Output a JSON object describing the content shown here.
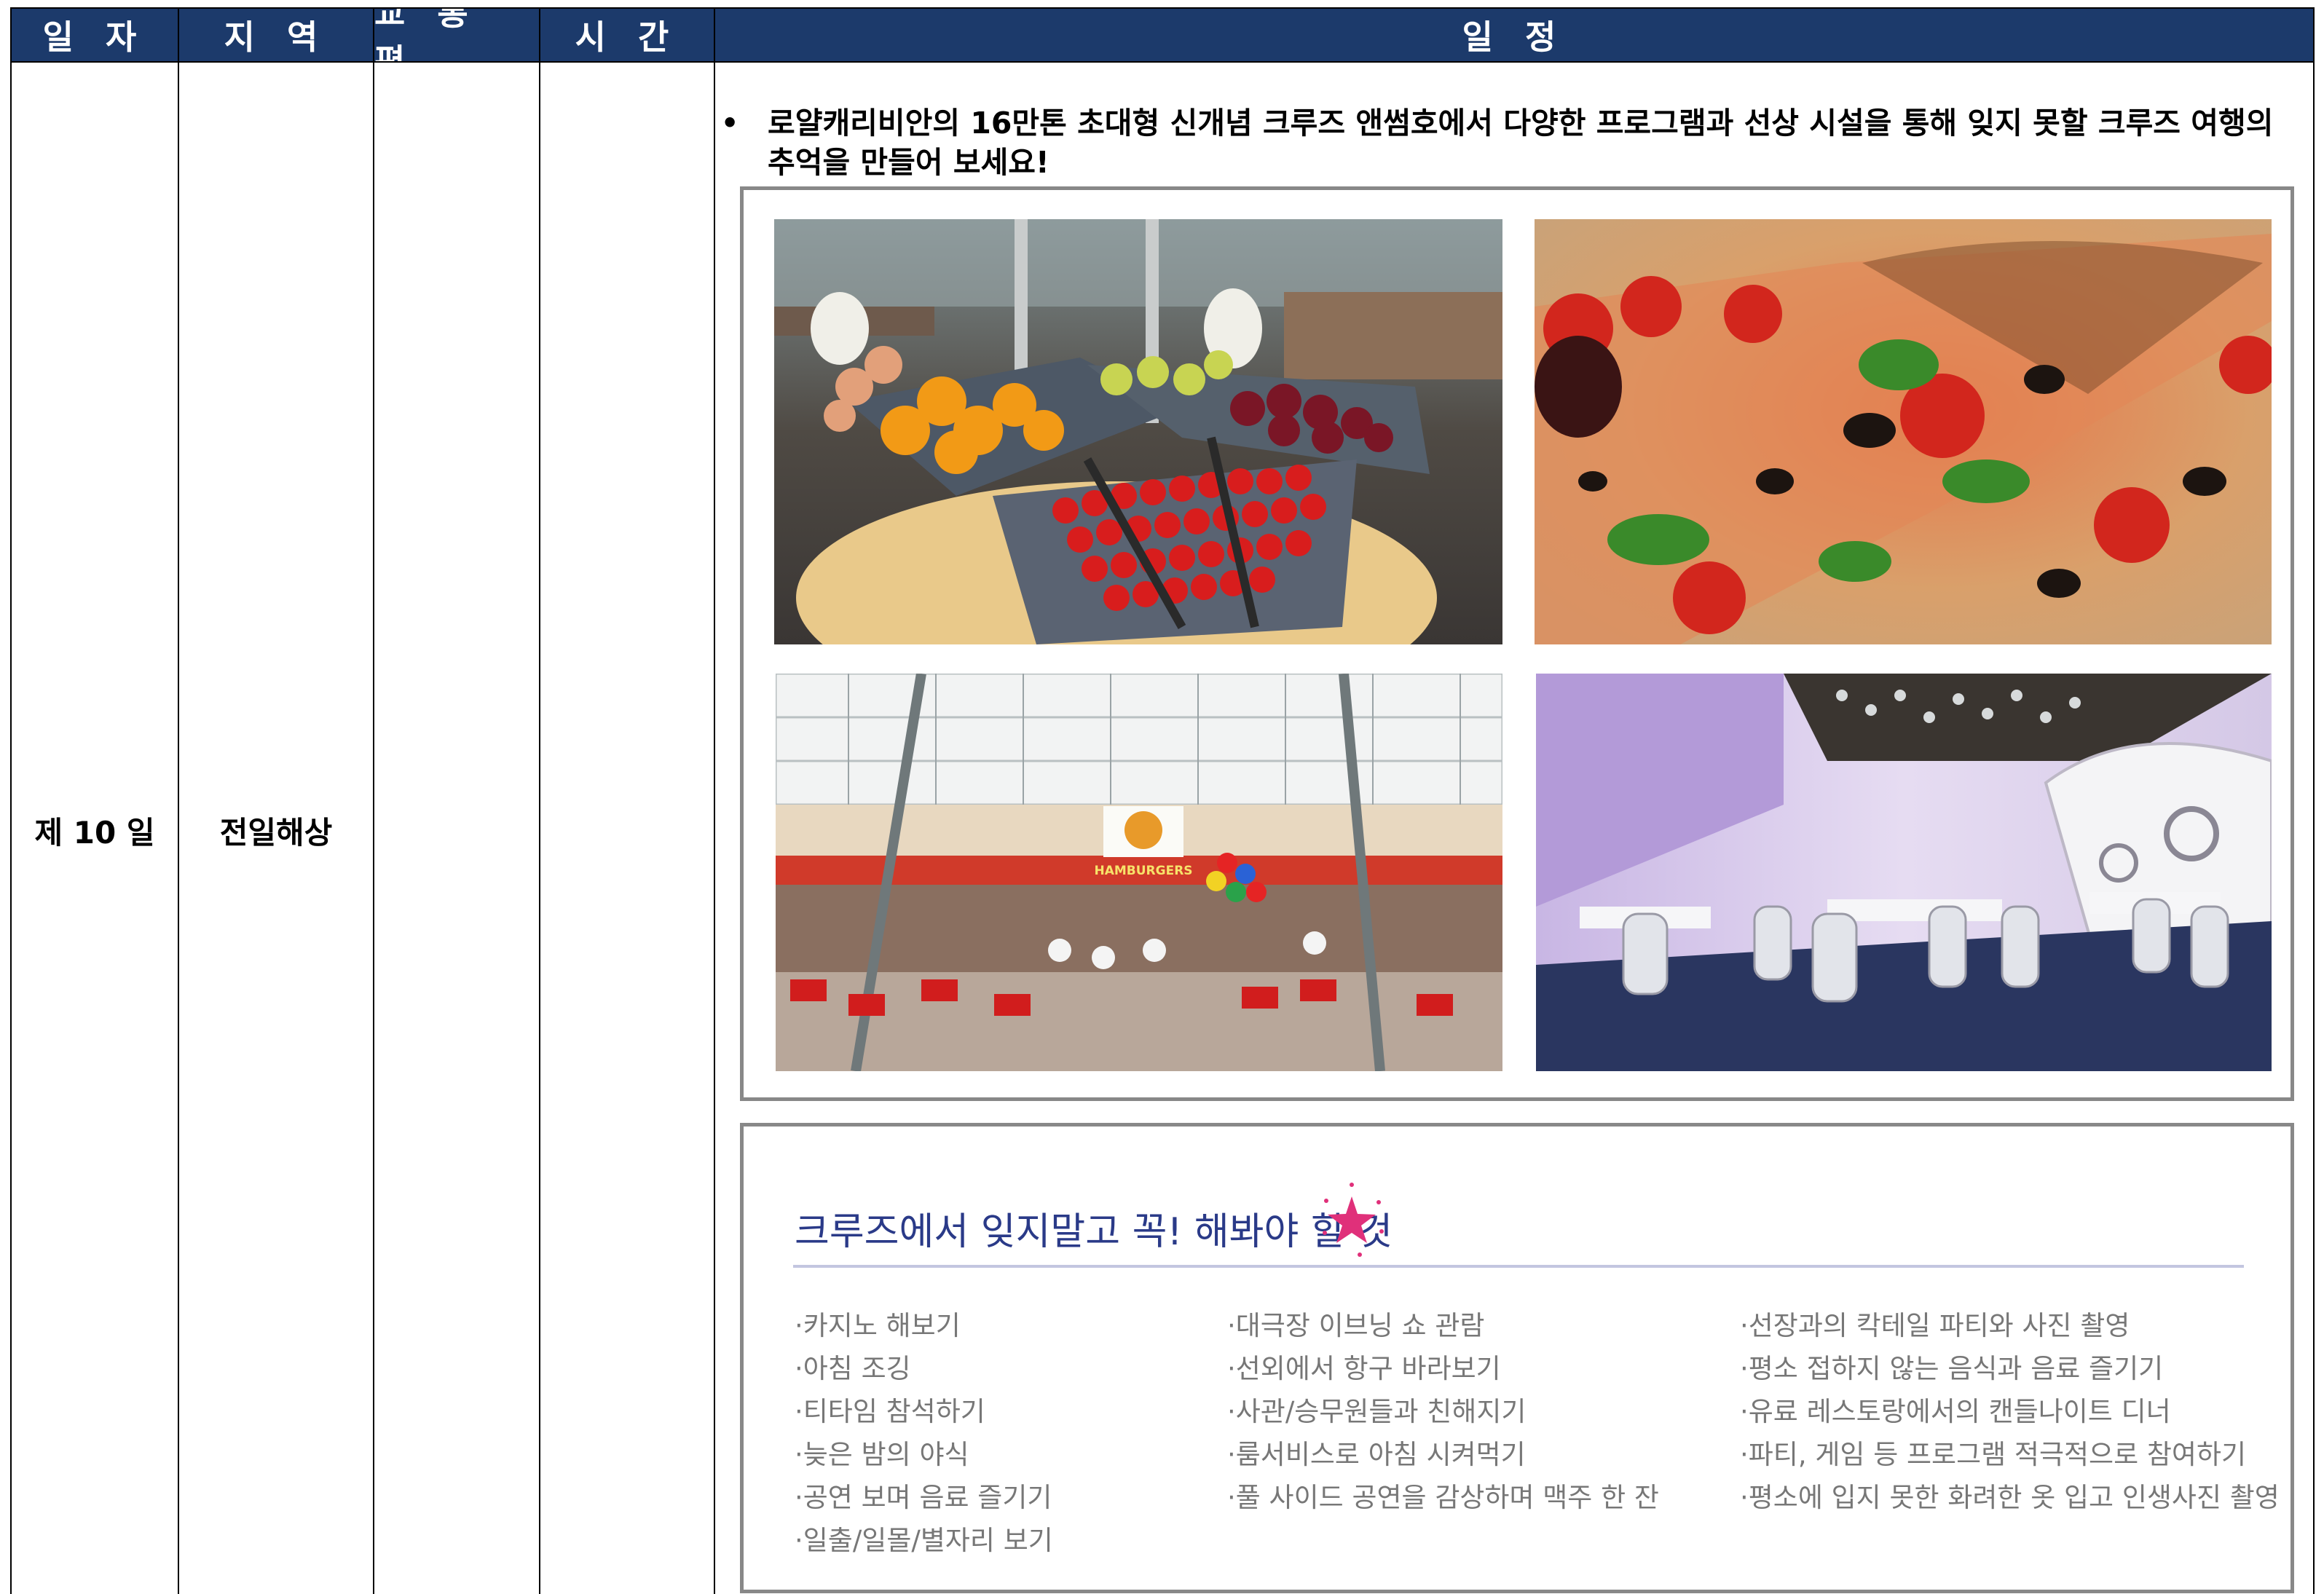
{
  "header": {
    "col_date": "일 자",
    "col_region": "지 역",
    "col_transport": "교 통 편",
    "col_time": "시 간",
    "col_schedule": "일 정"
  },
  "row": {
    "day": "제 10 일",
    "region": "전일해상",
    "transport": "",
    "time": "",
    "intro_bullet": "•",
    "intro_text": "로얄캐리비안의 16만톤 초대형 신개념 크루즈 앤썸호에서 다양한 프로그램과 선상 시설을 통해 잊지 못할 크루즈 여행의 추억을 만들어 보세요!"
  },
  "photos": [
    {
      "name": "fruit-buffet-photo",
      "subject": "fruit buffet"
    },
    {
      "name": "pizza-photo",
      "subject": "pizza"
    },
    {
      "name": "burger-cafe-deck-photo",
      "subject": "boardwalk burger cafe",
      "sign": "HAMBURGERS"
    },
    {
      "name": "dining-room-photo",
      "subject": "themed dining room"
    }
  ],
  "must_do": {
    "title": "크루즈에서 잊지말고 꼭! 해봐야 할 것",
    "col1": [
      "·카지노 해보기",
      "·아침 조깅",
      "·티타임 참석하기",
      "·늦은 밤의 야식",
      "·공연 보며 음료 즐기기",
      "·일출/일몰/별자리 보기"
    ],
    "col2": [
      "·대극장 이브닝 쇼 관람",
      "·선외에서 항구 바라보기",
      "·사관/승무원들과 친해지기",
      "·룸서비스로 아침 시켜먹기",
      "·풀 사이드 공연을 감상하며 맥주 한 잔"
    ],
    "col3": [
      "·선장과의 칵테일 파티와 사진 촬영",
      "·평소 접하지 않는 음식과 음료 즐기기",
      "·유료 레스토랑에서의 캔들나이트 디너",
      "·파티, 게임 등 프로그램 적극적으로 참여하기",
      "·평소에 입지 못한 화려한 옷 입고 인생사진 촬영"
    ]
  },
  "colors": {
    "header_bg": "#1c3a6b",
    "title_color": "#2a3a88",
    "star_color": "#e0307a",
    "list_text": "#777777"
  }
}
